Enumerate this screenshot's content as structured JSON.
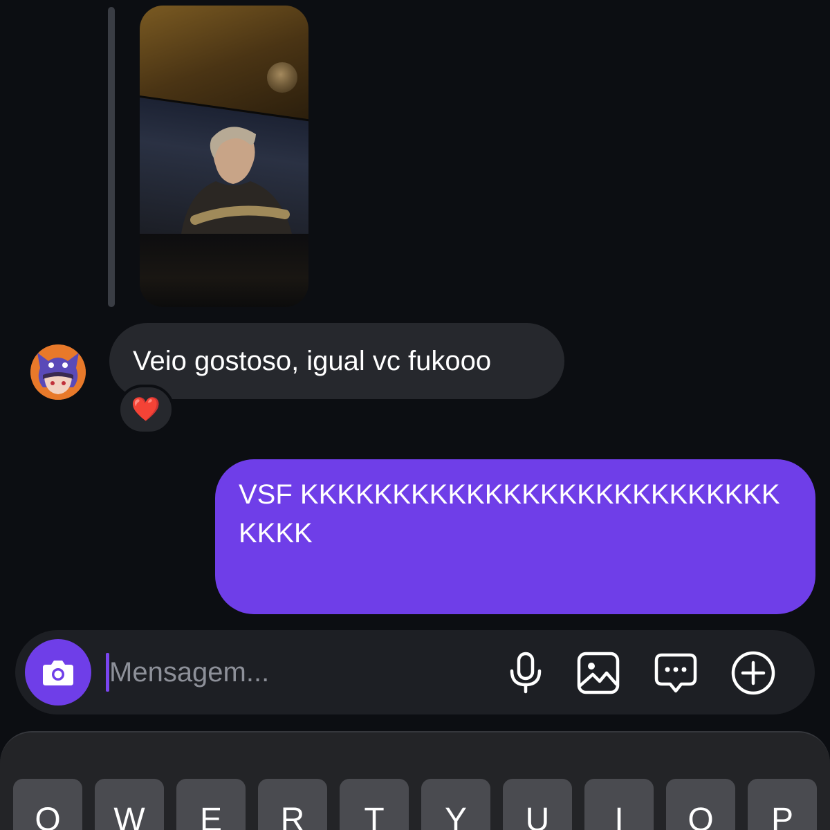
{
  "story_reply": {
    "image_label": "Shared story image"
  },
  "incoming_message": {
    "text": "Veio gostoso, igual vc fukooo",
    "reaction": "❤️"
  },
  "outgoing_message": {
    "text": "VSF KKKKKKKKKKKKKKKKKKKKKKKKKKKKKK"
  },
  "composer": {
    "placeholder": "Mensagem...",
    "value": "",
    "icons": [
      "camera-icon",
      "microphone-icon",
      "gallery-icon",
      "sticker-icon",
      "plus-icon"
    ]
  },
  "keyboard": {
    "top_row": [
      "Q",
      "W",
      "E",
      "R",
      "T",
      "Y",
      "U",
      "I",
      "O",
      "P"
    ]
  },
  "colors": {
    "background": "#0c0e12",
    "incoming_bubble": "#26282d",
    "outgoing_bubble": "#6f3ee8",
    "accent": "#6f3ee8",
    "keyboard": "#232427",
    "key": "#4a4b50"
  }
}
